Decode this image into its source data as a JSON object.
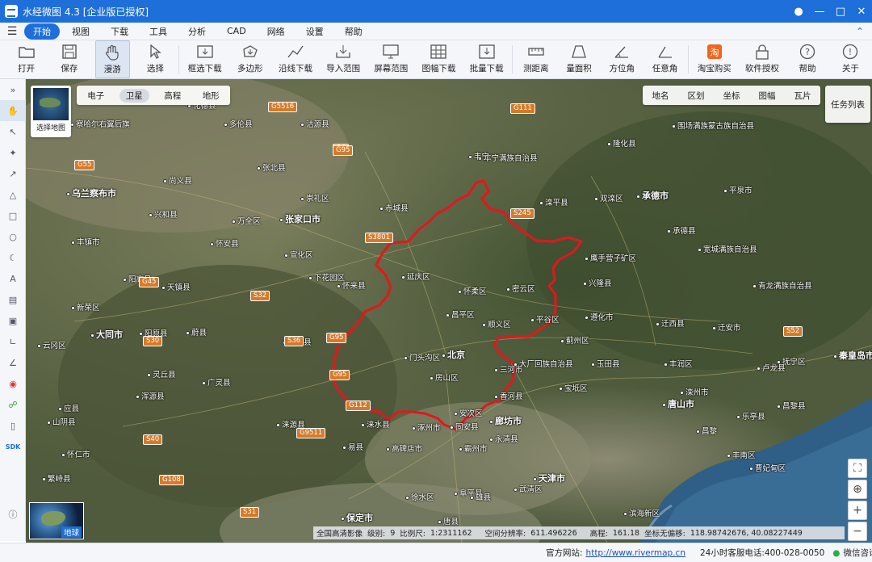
{
  "app": {
    "title": "水经微图 4.3 [企业版已授权]"
  },
  "menu": {
    "items": [
      "开始",
      "视图",
      "下载",
      "工具",
      "分析",
      "CAD",
      "网络",
      "设置",
      "帮助"
    ],
    "active": "开始"
  },
  "toolbar": {
    "open": "打开",
    "save": "保存",
    "pan": "漫游",
    "select": "选择",
    "box_download": "框选下载",
    "polygon": "多边形",
    "line_download": "沿线下载",
    "import_range": "导入范围",
    "screen_range": "屏幕范围",
    "sheet_download": "图幅下载",
    "batch_download": "批量下载",
    "measure_distance": "测距离",
    "measure_area": "量面积",
    "azimuth": "方位角",
    "any_angle": "任意角",
    "taobao": "淘宝购买",
    "license": "软件授权",
    "help": "帮助",
    "about": "关于"
  },
  "map": {
    "basemap_tabs": [
      "电子",
      "卫星",
      "高程",
      "地形"
    ],
    "basemap_active": "卫星",
    "select_map": "选择地图",
    "overlay_tabs": [
      "地名",
      "区划",
      "坐标",
      "图幅",
      "瓦片"
    ],
    "task_list": "任务列表",
    "globe_label": "地球",
    "status": {
      "imagery": "全国高清影像",
      "level_label": "级别:",
      "level": "9",
      "scale_label": "比例尺:",
      "scale": "1:2311162",
      "res_label": "空间分辨率:",
      "resolution": "611.496226",
      "elev_label": "高程:",
      "elevation": "161.18",
      "coord_label": "坐标无偏移:",
      "coords": "118.98742676, 40.08227449"
    },
    "places": [
      {
        "t": "乌兰察布市",
        "big": true
      },
      {
        "t": "张家口市",
        "big": true
      },
      {
        "t": "大同市",
        "big": true
      },
      {
        "t": "承德市",
        "big": true
      },
      {
        "t": "北京",
        "big": true
      },
      {
        "t": "廊坊市",
        "big": true
      },
      {
        "t": "唐山市",
        "big": true
      },
      {
        "t": "秦皇岛市",
        "big": true
      },
      {
        "t": "天津市",
        "big": true
      },
      {
        "t": "保定市",
        "big": true
      },
      {
        "t": "察哈尔右翼后旗"
      },
      {
        "t": "化德县"
      },
      {
        "t": "多伦县"
      },
      {
        "t": "丰宁满族自治县"
      },
      {
        "t": "隆化县"
      },
      {
        "t": "围场满族蒙古族自治县"
      },
      {
        "t": "尚义县"
      },
      {
        "t": "张北县"
      },
      {
        "t": "沽源县"
      },
      {
        "t": "崇礼区"
      },
      {
        "t": "赤城县"
      },
      {
        "t": "滦平县"
      },
      {
        "t": "双滦区"
      },
      {
        "t": "平泉市"
      },
      {
        "t": "兴和县"
      },
      {
        "t": "万全区"
      },
      {
        "t": "怀安县"
      },
      {
        "t": "宣化区"
      },
      {
        "t": "下花园区"
      },
      {
        "t": "怀来县"
      },
      {
        "t": "延庆区"
      },
      {
        "t": "怀柔区"
      },
      {
        "t": "密云区"
      },
      {
        "t": "鹰手营子矿区"
      },
      {
        "t": "兴隆县"
      },
      {
        "t": "承德县"
      },
      {
        "t": "宽城满族自治县"
      },
      {
        "t": "青龙满族自治县"
      },
      {
        "t": "丰镇市"
      },
      {
        "t": "阳高县"
      },
      {
        "t": "天镇县"
      },
      {
        "t": "新荣区"
      },
      {
        "t": "阳原县"
      },
      {
        "t": "蔚县"
      },
      {
        "t": "涿鹿县"
      },
      {
        "t": "昌平区"
      },
      {
        "t": "顺义区"
      },
      {
        "t": "平谷区"
      },
      {
        "t": "遵化市"
      },
      {
        "t": "迁西县"
      },
      {
        "t": "迁安市"
      },
      {
        "t": "抚宁区"
      },
      {
        "t": "门头沟区"
      },
      {
        "t": "蓟州区"
      },
      {
        "t": "玉田县"
      },
      {
        "t": "丰润区"
      },
      {
        "t": "滦州市"
      },
      {
        "t": "昌黎县"
      },
      {
        "t": "卢龙县"
      },
      {
        "t": "房山区"
      },
      {
        "t": "涞水县"
      },
      {
        "t": "涿州市"
      },
      {
        "t": "固安县"
      },
      {
        "t": "香河县"
      },
      {
        "t": "宝坻区"
      },
      {
        "t": "丰南区"
      },
      {
        "t": "乐亭县"
      },
      {
        "t": "灵丘县"
      },
      {
        "t": "广灵县"
      },
      {
        "t": "浑源县"
      },
      {
        "t": "涞源县"
      },
      {
        "t": "易县"
      },
      {
        "t": "高碑店市"
      },
      {
        "t": "霸州市"
      },
      {
        "t": "永清县"
      },
      {
        "t": "滨海新区"
      },
      {
        "t": "繁峙县"
      },
      {
        "t": "阜平县"
      },
      {
        "t": "唐县"
      },
      {
        "t": "徐水区"
      },
      {
        "t": "雄县"
      },
      {
        "t": "应县"
      },
      {
        "t": "山阴县"
      },
      {
        "t": "怀仁市"
      },
      {
        "t": "云冈区"
      },
      {
        "t": "三河市"
      },
      {
        "t": "大厂回族自治县"
      },
      {
        "t": "武清区"
      },
      {
        "t": "安次区"
      },
      {
        "t": "曹妃甸区"
      },
      {
        "t": "丰宁"
      },
      {
        "t": "昌黎"
      }
    ],
    "roads": [
      "G55",
      "G5516",
      "G6",
      "G95",
      "G111",
      "S3801",
      "G45",
      "S32",
      "S30",
      "S36",
      "G95",
      "G95",
      "S40",
      "G9511",
      "G108",
      "S31",
      "S52",
      "G112",
      "S245"
    ]
  },
  "statusbar": {
    "site_label": "官方网站:",
    "site_url": "http://www.rivermap.cn",
    "hotline_label": "24小时客服电话:",
    "hotline": "400-028-0050",
    "wechat": "微信咨询"
  }
}
